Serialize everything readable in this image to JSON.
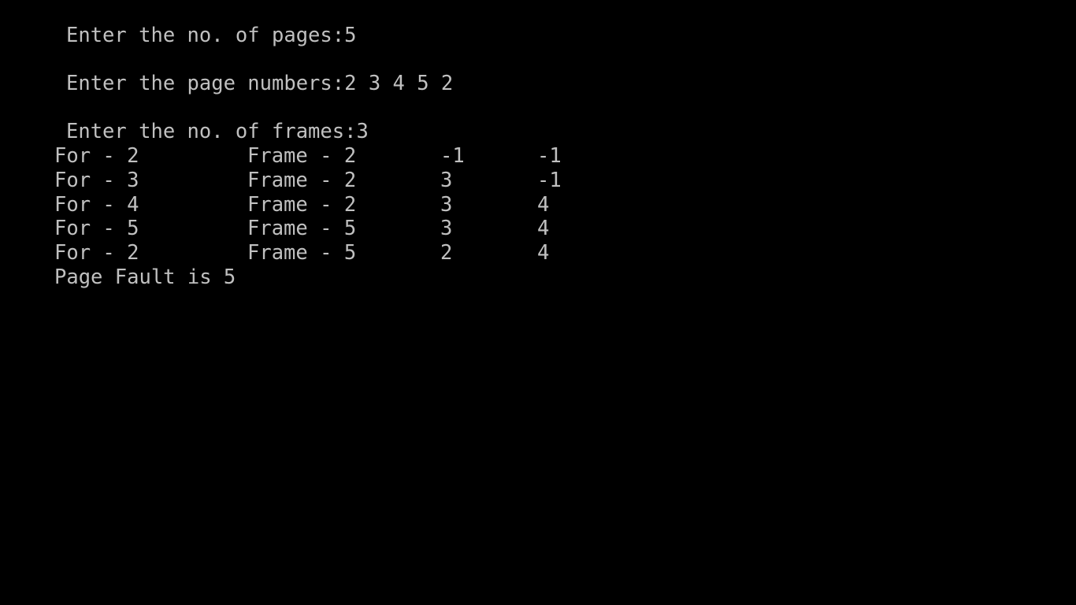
{
  "prompts": [
    {
      "label": "Enter the no. of pages:",
      "value": "5"
    },
    {
      "label": "Enter the page numbers:",
      "value": "2 3 4 5 2"
    },
    {
      "label": "Enter the no. of frames:",
      "value": "3"
    }
  ],
  "rows": [
    {
      "for": "For - 2",
      "frame": "Frame - 2",
      "f2": "-1",
      "f3": "-1"
    },
    {
      "for": "For - 3",
      "frame": "Frame - 2",
      "f2": "3",
      "f3": "-1"
    },
    {
      "for": "For - 4",
      "frame": "Frame - 2",
      "f2": "3",
      "f3": "4"
    },
    {
      "for": "For - 5",
      "frame": "Frame - 5",
      "f2": "3",
      "f3": "4"
    },
    {
      "for": "For - 2",
      "frame": "Frame - 5",
      "f2": "2",
      "f3": "4"
    }
  ],
  "summary": "Page Fault is 5"
}
